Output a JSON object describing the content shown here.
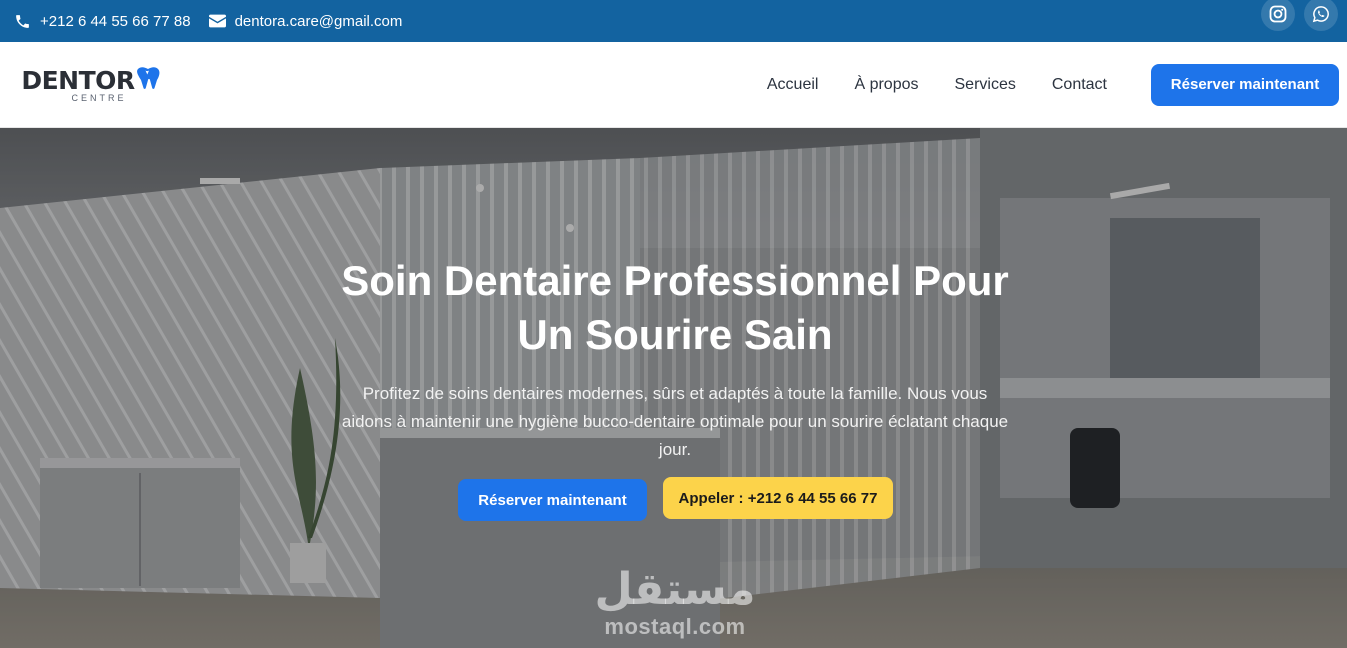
{
  "topbar": {
    "phone": "+212 6 44 55 66 77 88",
    "email": "dentora.care@gmail.com",
    "icons": [
      "phone-icon",
      "envelope-icon",
      "instagram-icon",
      "whatsapp-icon"
    ]
  },
  "logo": {
    "main": "DENTOR",
    "sub": "CENTRE"
  },
  "nav": {
    "items": [
      "Accueil",
      "À propos",
      "Services",
      "Contact"
    ],
    "cta": "Réserver maintenant"
  },
  "hero": {
    "title_line1": "Soin Dentaire Professionnel Pour",
    "title_line2": "Un Sourire Sain",
    "description": "Profitez de soins dentaires modernes, sûrs et adaptés à toute la famille. Nous vous aidons à maintenir une hygiène bucco-dentaire optimale pour un sourire éclatant chaque jour.",
    "btn_book": "Réserver maintenant",
    "btn_call": "Appeler : +212 6 44 55 66 77"
  },
  "watermark": {
    "arabic": "مستقل",
    "latin": "mostaql.com"
  },
  "colors": {
    "topbar": "#1363a0",
    "primary": "#1e74ea",
    "yellow": "#fcd34a",
    "dark_text": "#2c3440"
  }
}
